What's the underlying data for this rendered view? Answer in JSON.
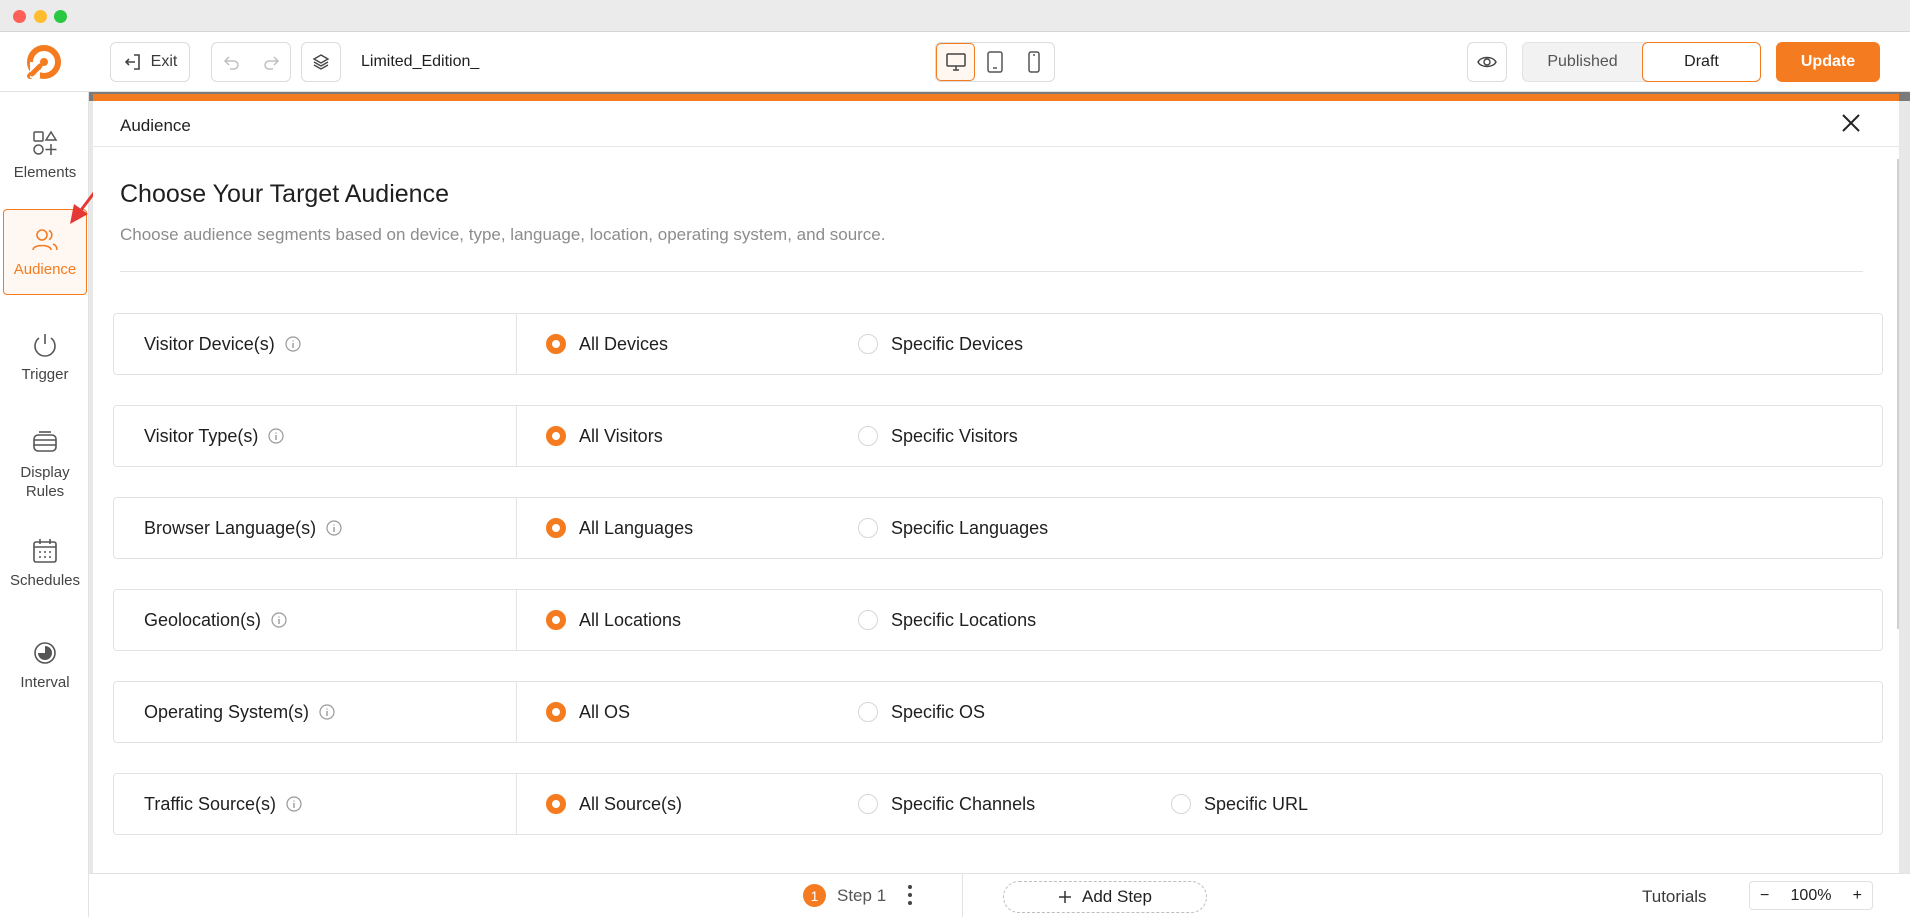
{
  "window": {
    "controls": [
      "close",
      "minimize",
      "maximize"
    ]
  },
  "topbar": {
    "exit_label": "Exit",
    "doc_title": "Limited_Edition_",
    "devices": [
      "desktop-icon",
      "tablet-icon",
      "mobile-icon"
    ],
    "active_device": "desktop",
    "status_published": "Published",
    "status_draft": "Draft",
    "active_status": "Draft",
    "update_label": "Update"
  },
  "sidebar": {
    "items": [
      {
        "label": "Elements",
        "icon": "shapes-icon"
      },
      {
        "label": "Audience",
        "icon": "users-icon",
        "active": true
      },
      {
        "label": "Trigger",
        "icon": "power-icon"
      },
      {
        "label": "Display Rules",
        "icon": "display-rules-icon"
      },
      {
        "label": "Schedules",
        "icon": "calendar-icon"
      },
      {
        "label": "Interval",
        "icon": "interval-icon"
      }
    ]
  },
  "panel": {
    "title": "Audience",
    "heading": "Choose Your Target Audience",
    "description": "Choose audience segments based on device, type, language, location, operating system, and source.",
    "rows": [
      {
        "label": "Visitor Device(s)",
        "options": [
          "All Devices",
          "Specific Devices"
        ],
        "selected": 0
      },
      {
        "label": "Visitor Type(s)",
        "options": [
          "All Visitors",
          "Specific Visitors"
        ],
        "selected": 0
      },
      {
        "label": "Browser Language(s)",
        "options": [
          "All Languages",
          "Specific Languages"
        ],
        "selected": 0
      },
      {
        "label": "Geolocation(s)",
        "options": [
          "All Locations",
          "Specific Locations"
        ],
        "selected": 0
      },
      {
        "label": "Operating System(s)",
        "options": [
          "All OS",
          "Specific OS"
        ],
        "selected": 0
      },
      {
        "label": "Traffic Source(s)",
        "options": [
          "All Source(s)",
          "Specific Channels",
          "Specific URL"
        ],
        "selected": 0
      }
    ]
  },
  "bottombar": {
    "step_number": "1",
    "step_label": "Step 1",
    "add_step_label": "Add Step",
    "tutorials_label": "Tutorials",
    "zoom_value": "100%",
    "zoom_minus": "−",
    "zoom_plus": "+"
  },
  "colors": {
    "accent": "#f47b20"
  }
}
